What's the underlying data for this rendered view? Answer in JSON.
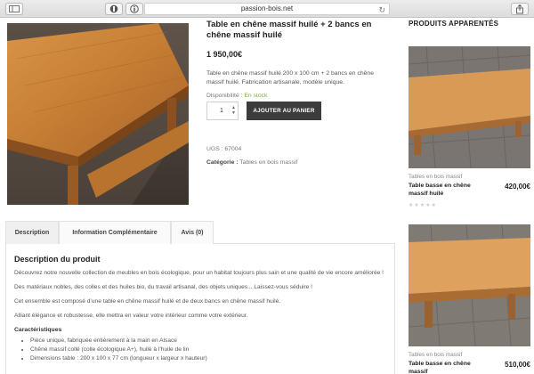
{
  "browser": {
    "url": "passion-bois.net",
    "reload_glyph": "↻"
  },
  "product": {
    "title": "Table en chêne massif huilé + 2 bancs en chêne massif huilé",
    "price": "1 950,00€",
    "description": "Table en chêne massif huilé 200 x 100 cm + 2 bancs en chêne massif huilé. Fabrication artisanale, modèle unique.",
    "availability_label": "Disponibilité :",
    "availability_value": "En stock",
    "quantity": "1",
    "add_to_cart": "AJOUTER AU PANIER",
    "sku_label": "UGS :",
    "sku_value": "67004",
    "category_label": "Catégorie :",
    "category_value": "Tables en bois massif"
  },
  "tabs": [
    {
      "label": "Description"
    },
    {
      "label": "Information Complémentaire"
    },
    {
      "label": "Avis (0)"
    }
  ],
  "panel": {
    "heading": "Description du produit",
    "paragraphs": [
      "Découvrez notre nouvelle collection de meubles en bois écologique, pour un habitat toujours plus sain et une qualité de vie encore améliorée !",
      "Des matériaux nobles, des colles et des huiles bio, du travail artisanal, des objets uniques... Laissez-vous séduire !",
      "Cet ensemble est composé d’une table en chêne massif huilé et de deux bancs en chêne massif huilé.",
      "Alliant élégance et robustesse, elle mettra en valeur votre intérieur comme votre extérieur."
    ],
    "features_heading": "Caractéristiques",
    "features": [
      "Pièce unique, fabriquée entièrement à la main en Alsace",
      "Chêne massif collé (colle écologique A+), huilé à l’huile de lin",
      "Dimensions table : 200 x 100 x 77 cm (longueur x largeur x hauteur)"
    ]
  },
  "related": {
    "title": "PRODUITS APPARENTÉS",
    "items": [
      {
        "category": "Tables en bois massif",
        "name": "Table basse en chêne massif huilé",
        "price": "420,00€",
        "rating": 0
      },
      {
        "category": "Tables en bois massif",
        "name": "Table basse en chêne massif",
        "price": "510,00€",
        "rating": 0
      }
    ]
  },
  "colors": {
    "in_stock": "#7fb23b",
    "button_bg": "#3c3c3c",
    "wood": "#c8823c"
  }
}
